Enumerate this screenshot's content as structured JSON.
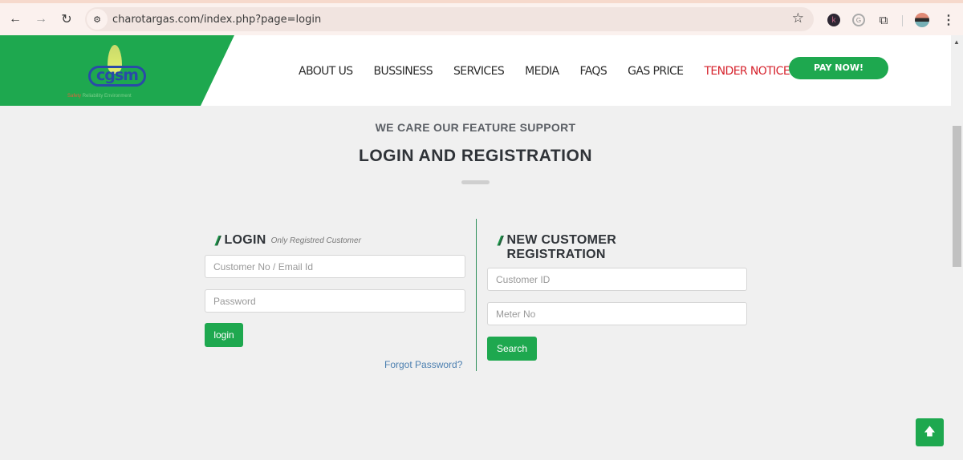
{
  "browser": {
    "url": "charotargas.com/index.php?page=login",
    "icons": {
      "back": "←",
      "forward": "→",
      "reload": "↻",
      "site_info": "⚙",
      "star": "☆",
      "ext_k": "k",
      "ext_g": "G",
      "puzzle": "⧉",
      "menu": "⋮"
    }
  },
  "header": {
    "logo_text": "cgsm",
    "logo_tagline_accent": "Safety",
    "logo_tagline": "Reliability Environment",
    "nav": [
      {
        "label": "ABOUT US"
      },
      {
        "label": "BUSSINESS"
      },
      {
        "label": "SERVICES"
      },
      {
        "label": "MEDIA"
      },
      {
        "label": "FAQS"
      },
      {
        "label": "GAS PRICE"
      },
      {
        "label": "TENDER NOTICE"
      }
    ],
    "pay_now": "PAY NOW!",
    "colors": {
      "brand_green": "#1ea84f",
      "tender_red": "#d6222c"
    }
  },
  "section": {
    "subtitle": "WE CARE OUR FEATURE SUPPORT",
    "title": "LOGIN AND REGISTRATION"
  },
  "login": {
    "slashes": "//",
    "title": "LOGIN",
    "note": "Only Registred Customer",
    "customer_placeholder": "Customer No / Email Id",
    "password_placeholder": "Password",
    "submit": "login",
    "forgot": "Forgot Password?"
  },
  "registration": {
    "slashes": "//",
    "title_line1": "NEW CUSTOMER",
    "title_line2": "REGISTRATION",
    "customer_id_placeholder": "Customer ID",
    "meter_placeholder": "Meter No",
    "submit": "Search"
  },
  "scroll_top_icon": "🡅"
}
